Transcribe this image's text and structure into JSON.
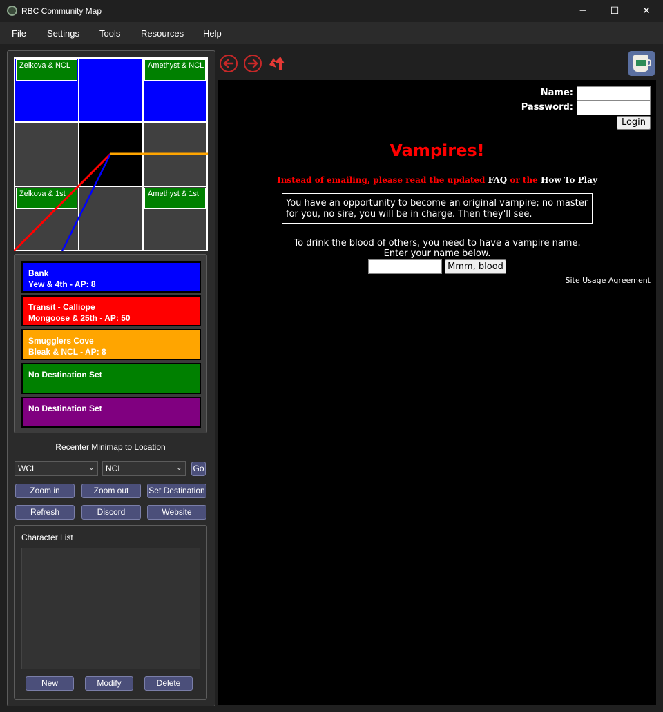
{
  "window": {
    "title": "RBC Community Map",
    "minimize_glyph": "─",
    "maximize_glyph": "☐",
    "close_glyph": "✕"
  },
  "menu": [
    "File",
    "Settings",
    "Tools",
    "Resources",
    "Help"
  ],
  "minimap": {
    "tiles": [
      {
        "label": "Zelkova & NCL",
        "color": "#0000ff"
      },
      {
        "label": "",
        "color": "#0000ff"
      },
      {
        "label": "Amethyst & NCL",
        "color": "#0000ff"
      },
      {
        "label": "",
        "color": "#404040"
      },
      {
        "label": "",
        "color": "#000000"
      },
      {
        "label": "",
        "color": "#404040"
      },
      {
        "label": "Zelkova & 1st",
        "color": "#404040"
      },
      {
        "label": "",
        "color": "#404040"
      },
      {
        "label": "Amethyst & 1st",
        "color": "#404040"
      }
    ],
    "route_colors": {
      "red": "#ff0000",
      "blue": "#0000ff",
      "orange": "#ffa500"
    }
  },
  "destinations": [
    {
      "line1": "Bank",
      "line2": "Yew & 4th - AP: 8",
      "color": "#0000ff"
    },
    {
      "line1": "Transit - Calliope",
      "line2": "Mongoose & 25th - AP: 50",
      "color": "#ff0000"
    },
    {
      "line1": "Smugglers Cove",
      "line2": "Bleak & NCL - AP: 8",
      "color": "#ffa500"
    },
    {
      "line1": "No Destination Set",
      "line2": "",
      "color": "#008000"
    },
    {
      "line1": "No Destination Set",
      "line2": "",
      "color": "#800080"
    }
  ],
  "recenter": {
    "label": "Recenter Minimap to Location",
    "street_a": "WCL",
    "street_b": "NCL",
    "go_label": "Go"
  },
  "buttons": {
    "zoom_in": "Zoom in",
    "zoom_out": "Zoom out",
    "set_destination": "Set Destination",
    "refresh": "Refresh",
    "discord": "Discord",
    "website": "Website"
  },
  "character_list": {
    "title": "Character List",
    "new": "New",
    "modify": "Modify",
    "delete": "Delete"
  },
  "browser": {
    "name_label": "Name:",
    "password_label": "Password:",
    "login_button": "Login",
    "title": "Vampires!",
    "notice_before": "Instead of emailing, please read the updated ",
    "faq": "FAQ",
    "notice_middle": " or the ",
    "how_to_play": "How To Play",
    "intro": "You have an opportunity to become an original vampire; no master for you, no sire, you will be in charge. Then they'll see.",
    "drink_line1": "To drink the blood of others, you need to have a vampire name.",
    "drink_line2": "Enter your name below.",
    "submit_button": "Mmm, blood",
    "agreement_link": "Site Usage Agreement"
  }
}
